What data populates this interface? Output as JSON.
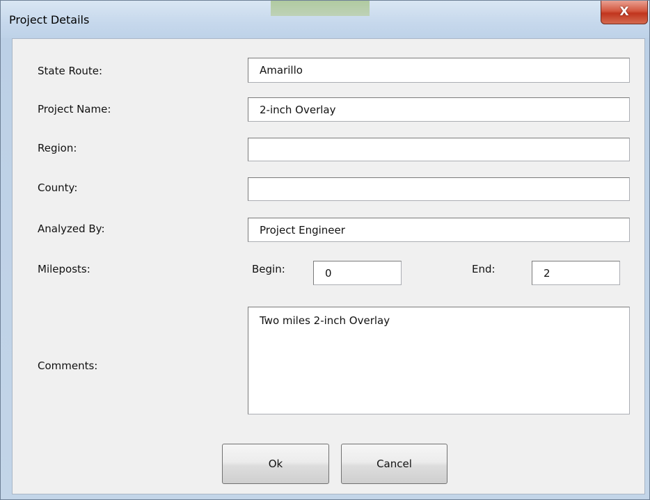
{
  "window": {
    "title": "Project Details",
    "close_label": "X"
  },
  "form": {
    "state_route": {
      "label": "State Route:",
      "value": "Amarillo"
    },
    "project_name": {
      "label": "Project Name:",
      "value": "2-inch Overlay"
    },
    "region": {
      "label": "Region:",
      "value": ""
    },
    "county": {
      "label": "County:",
      "value": ""
    },
    "analyzed_by": {
      "label": "Analyzed By:",
      "value": "Project Engineer"
    },
    "mileposts": {
      "label": "Mileposts:",
      "begin_label": "Begin:",
      "begin_value": "0",
      "end_label": "End:",
      "end_value": "2"
    },
    "comments": {
      "label": "Comments:",
      "value": "Two miles 2-inch Overlay"
    }
  },
  "buttons": {
    "ok_label": "Ok",
    "cancel_label": "Cancel"
  },
  "colors": {
    "close_button": "#c1351e",
    "dialog_background": "#f0f0f0",
    "frame": "#bcd0e6"
  }
}
